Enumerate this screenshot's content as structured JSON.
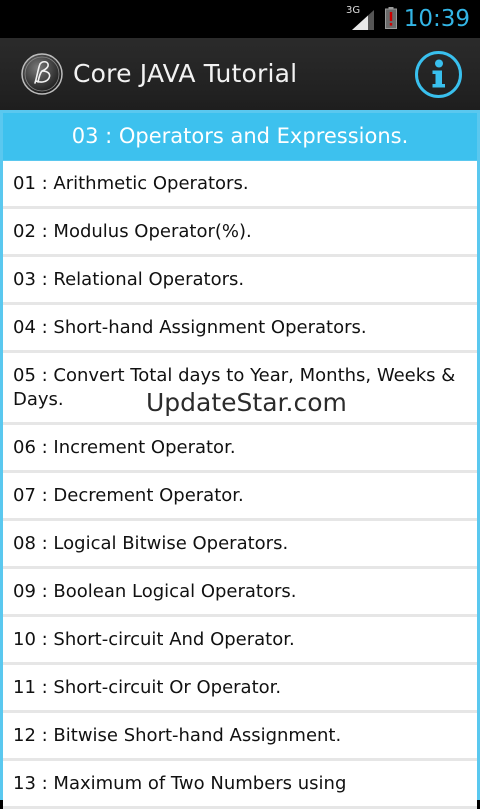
{
  "status_bar": {
    "network": "3G",
    "time": "10:39"
  },
  "action_bar": {
    "title": "Core JAVA Tutorial",
    "logo_icon": "script-b-logo",
    "info_icon": "info-icon"
  },
  "section": {
    "title": "03 : Operators and Expressions."
  },
  "items": [
    {
      "label": "01 : Arithmetic Operators."
    },
    {
      "label": "02 : Modulus Operator(%)."
    },
    {
      "label": "03 : Relational Operators."
    },
    {
      "label": "04 : Short-hand Assignment Operators."
    },
    {
      "label": "05 : Convert Total days to Year, Months, Weeks & Days."
    },
    {
      "label": "06 : Increment Operator."
    },
    {
      "label": "07 : Decrement Operator."
    },
    {
      "label": "08 : Logical Bitwise Operators."
    },
    {
      "label": "09 : Boolean Logical Operators."
    },
    {
      "label": "10 : Short-circuit And Operator."
    },
    {
      "label": "11 : Short-circuit Or Operator."
    },
    {
      "label": "12 : Bitwise Short-hand Assignment."
    },
    {
      "label": "13 : Maximum of Two Numbers using"
    }
  ],
  "watermark": "UpdateStar.com",
  "colors": {
    "accent": "#33b5e5",
    "header_bg": "#3dc1ee",
    "battery_warning": "#cc0000"
  }
}
